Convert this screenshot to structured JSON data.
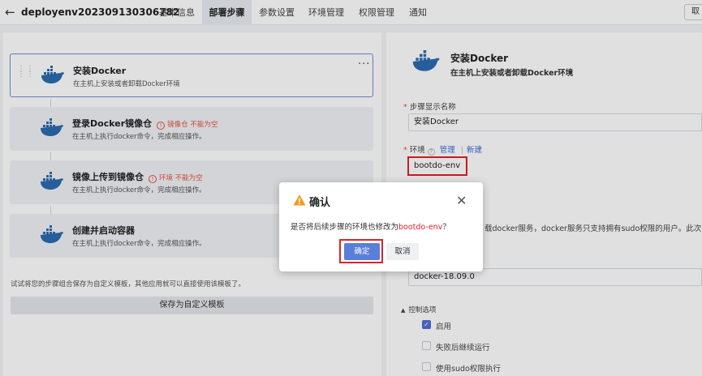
{
  "header": {
    "title": "deployenv202309130306782",
    "tabs": [
      "基本信息",
      "部署步骤",
      "参数设置",
      "环境管理",
      "权限管理",
      "通知"
    ],
    "active_tab": "部署步骤",
    "right_button": "取"
  },
  "steps": [
    {
      "title": "安装Docker",
      "desc": "在主机上安装或者卸载Docker环境",
      "warning": ""
    },
    {
      "title": "登录Docker镜像仓",
      "desc": "在主机上执行docker命令，完成相应操作。",
      "warning": "镜像仓 不能为空"
    },
    {
      "title": "镜像上传到镜像仓",
      "desc": "在主机上执行docker命令，完成相应操作。",
      "warning": "环境 不能为空"
    },
    {
      "title": "创建并启动容器",
      "desc": "在主机上执行docker命令，完成相应操作。",
      "warning": ""
    }
  ],
  "more_label": "···",
  "left_hint": "试试将您的步骤组合保存为自定义模板，其他应用就可以直接使用该模板了。",
  "save_template_label": "保存为自定义模板",
  "right": {
    "title": "安装Docker",
    "subtitle": "在主机上安装或者卸载Docker环境",
    "step_name_label": "步骤显示名称",
    "step_name_value": "安装Docker",
    "env_label": "环境",
    "manage_link": "管理",
    "sep": "|",
    "new_link": "新建",
    "env_value": "bootdo-env",
    "background_text": "载docker服务，docker服务只支持拥有sudo权限的用户。此次安",
    "version_value": "docker-18.09.0",
    "control_options_label": "控制选项",
    "options": [
      {
        "label": "启用",
        "checked": true
      },
      {
        "label": "失败后继续运行",
        "checked": false
      },
      {
        "label": "使用sudo权限执行",
        "checked": false
      }
    ]
  },
  "dialog": {
    "title": "确认",
    "message_prefix": "是否将后续步骤的环境也修改为",
    "message_env": "bootdo-env",
    "message_suffix": "？",
    "ok_label": "确定",
    "cancel_label": "取消"
  },
  "colors": {
    "accent": "#5a7fd9",
    "warning": "#e5533a",
    "highlight_box": "#e0212a",
    "docker_blue": "#2b6cb0"
  }
}
